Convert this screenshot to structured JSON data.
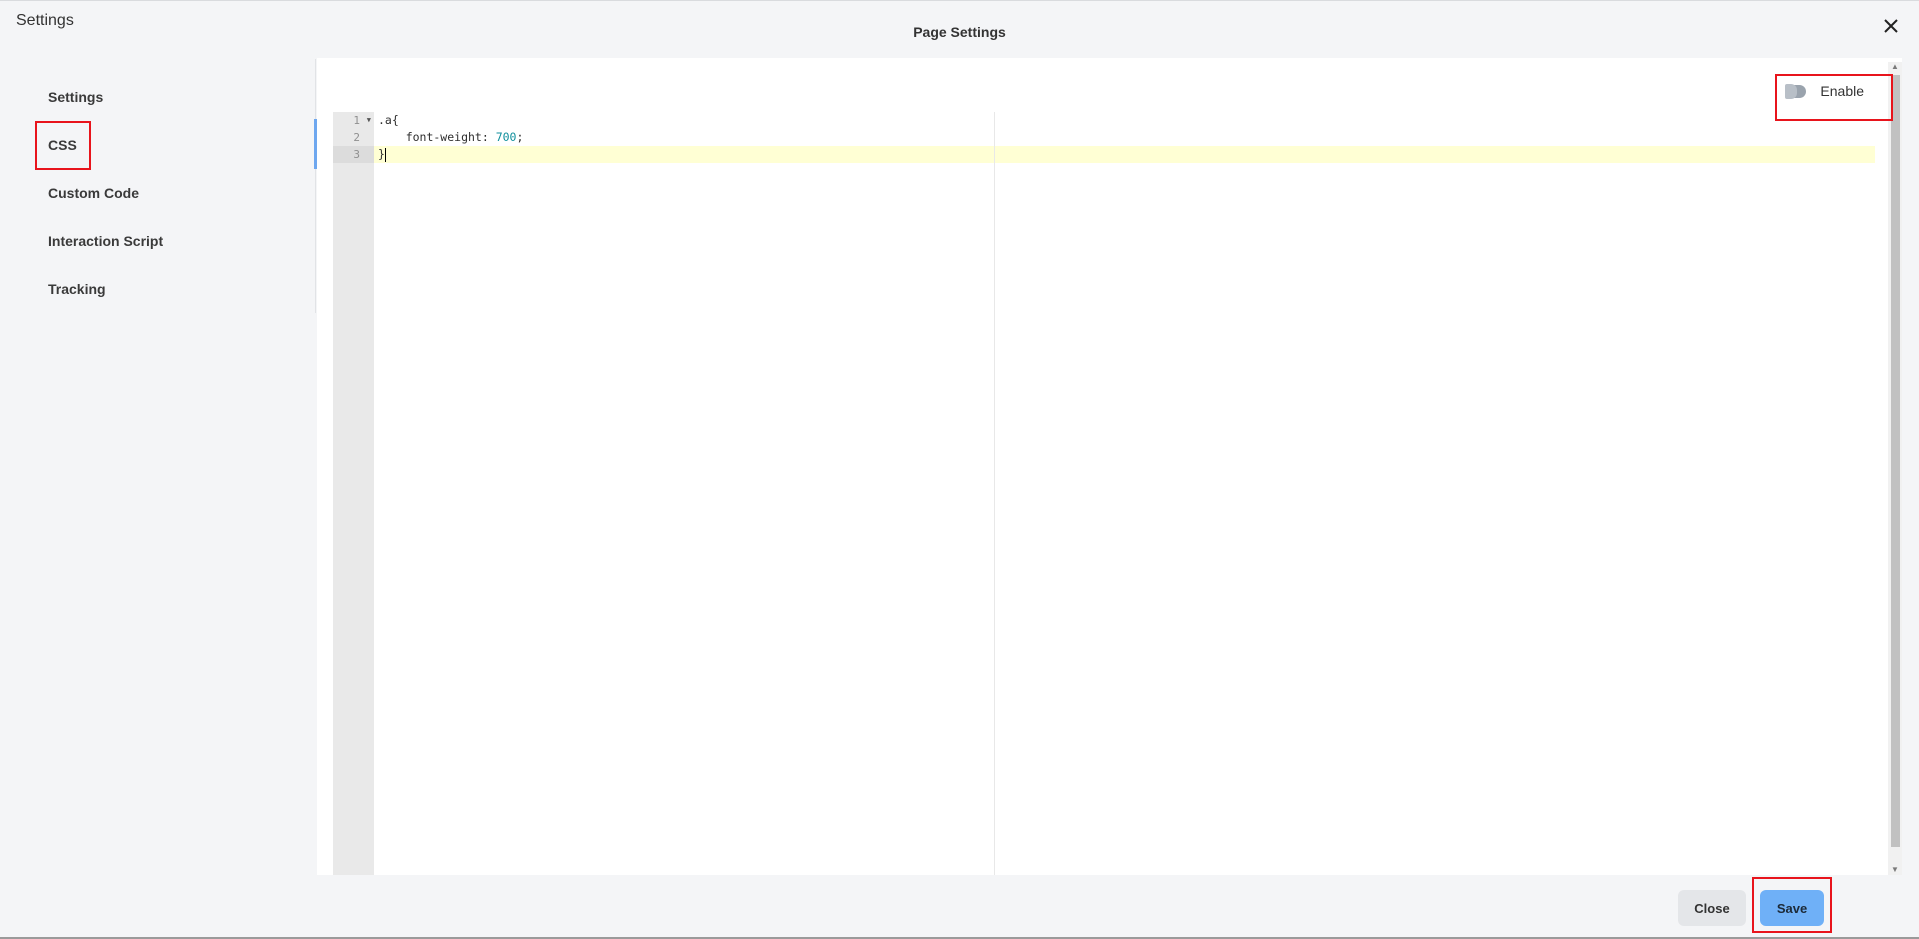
{
  "app": {
    "title": "Settings"
  },
  "dialog": {
    "title": "Page Settings",
    "close_icon": "close-icon"
  },
  "sidebar": {
    "items": [
      {
        "label": "Settings",
        "active": false
      },
      {
        "label": "CSS",
        "active": true
      },
      {
        "label": "Custom Code",
        "active": false
      },
      {
        "label": "Interaction Script",
        "active": false
      },
      {
        "label": "Tracking",
        "active": false
      }
    ]
  },
  "toggle": {
    "label": "Enable",
    "state": "off"
  },
  "editor": {
    "line_numbers": [
      "1",
      "2",
      "3"
    ],
    "lines": [
      {
        "text": ".a{"
      },
      {
        "prefix": "    font-weight: ",
        "number": "700",
        "suffix": ";"
      },
      {
        "text": "}"
      }
    ],
    "active_line": 3
  },
  "footer": {
    "close_label": "Close",
    "save_label": "Save"
  },
  "colors": {
    "highlight_box": "#e8141c",
    "save_button": "#6fb0f7",
    "active_line": "#ffffd4",
    "number_token": "#0f8f9c"
  }
}
